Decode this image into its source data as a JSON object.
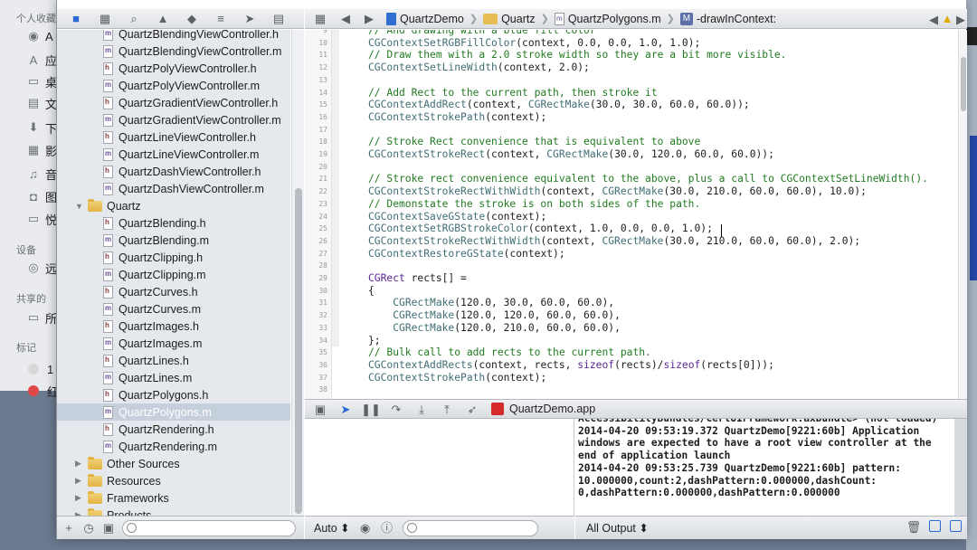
{
  "background_finder": {
    "sections": [
      "个人收藏",
      "设备",
      "共享的",
      "标记"
    ],
    "items": [
      {
        "icon": "airdrop-icon",
        "glyph": "◉",
        "label": "A"
      },
      {
        "icon": "applications-icon",
        "glyph": "A",
        "label": "应"
      },
      {
        "icon": "desktop-icon",
        "glyph": "▭",
        "label": "桌"
      },
      {
        "icon": "documents-icon",
        "glyph": "▤",
        "label": "文"
      },
      {
        "icon": "downloads-icon",
        "glyph": "⬇",
        "label": "下"
      },
      {
        "icon": "movies-icon",
        "glyph": "▦",
        "label": "影"
      },
      {
        "icon": "music-icon",
        "glyph": "♫",
        "label": "音"
      },
      {
        "icon": "pictures-icon",
        "glyph": "◘",
        "label": "图"
      },
      {
        "icon": "folder-icon",
        "glyph": "▭",
        "label": "悦"
      },
      {
        "icon": "disk-icon",
        "glyph": "◎",
        "label": "远"
      },
      {
        "icon": "network-icon",
        "glyph": "▭",
        "label": "所"
      }
    ],
    "tags": [
      {
        "label": "1",
        "color": "#d8d8d8"
      },
      {
        "label": "红",
        "color": "#e04848"
      }
    ]
  },
  "navigator": {
    "files": [
      {
        "type": "file",
        "ext": "m",
        "name": "QuartzBlendingViewController.h",
        "indent": 1
      },
      {
        "type": "file",
        "ext": "m",
        "name": "QuartzBlendingViewController.m",
        "indent": 1
      },
      {
        "type": "file",
        "ext": "h",
        "name": "QuartzPolyViewController.h",
        "indent": 1
      },
      {
        "type": "file",
        "ext": "m",
        "name": "QuartzPolyViewController.m",
        "indent": 1
      },
      {
        "type": "file",
        "ext": "h",
        "name": "QuartzGradientViewController.h",
        "indent": 1
      },
      {
        "type": "file",
        "ext": "m",
        "name": "QuartzGradientViewController.m",
        "indent": 1
      },
      {
        "type": "file",
        "ext": "h",
        "name": "QuartzLineViewController.h",
        "indent": 1
      },
      {
        "type": "file",
        "ext": "m",
        "name": "QuartzLineViewController.m",
        "indent": 1
      },
      {
        "type": "file",
        "ext": "h",
        "name": "QuartzDashViewController.h",
        "indent": 1
      },
      {
        "type": "file",
        "ext": "m",
        "name": "QuartzDashViewController.m",
        "indent": 1
      },
      {
        "type": "folder",
        "open": true,
        "name": "Quartz",
        "indent": 0
      },
      {
        "type": "file",
        "ext": "h",
        "name": "QuartzBlending.h",
        "indent": 1
      },
      {
        "type": "file",
        "ext": "m",
        "name": "QuartzBlending.m",
        "indent": 1
      },
      {
        "type": "file",
        "ext": "h",
        "name": "QuartzClipping.h",
        "indent": 1
      },
      {
        "type": "file",
        "ext": "m",
        "name": "QuartzClipping.m",
        "indent": 1
      },
      {
        "type": "file",
        "ext": "h",
        "name": "QuartzCurves.h",
        "indent": 1
      },
      {
        "type": "file",
        "ext": "m",
        "name": "QuartzCurves.m",
        "indent": 1
      },
      {
        "type": "file",
        "ext": "h",
        "name": "QuartzImages.h",
        "indent": 1
      },
      {
        "type": "file",
        "ext": "m",
        "name": "QuartzImages.m",
        "indent": 1
      },
      {
        "type": "file",
        "ext": "h",
        "name": "QuartzLines.h",
        "indent": 1
      },
      {
        "type": "file",
        "ext": "m",
        "name": "QuartzLines.m",
        "indent": 1
      },
      {
        "type": "file",
        "ext": "h",
        "name": "QuartzPolygons.h",
        "indent": 1
      },
      {
        "type": "file",
        "ext": "m",
        "name": "QuartzPolygons.m",
        "indent": 1,
        "selected": true
      },
      {
        "type": "file",
        "ext": "h",
        "name": "QuartzRendering.h",
        "indent": 1
      },
      {
        "type": "file",
        "ext": "m",
        "name": "QuartzRendering.m",
        "indent": 1
      },
      {
        "type": "folder",
        "open": false,
        "name": "Other Sources",
        "indent": 0
      },
      {
        "type": "folder",
        "open": false,
        "name": "Resources",
        "indent": 0
      },
      {
        "type": "folder",
        "open": false,
        "name": "Frameworks",
        "indent": 0
      },
      {
        "type": "folder",
        "open": false,
        "name": "Products",
        "indent": 0
      }
    ]
  },
  "jump_bar": {
    "project": "QuartzDemo",
    "group": "Quartz",
    "file": "QuartzPolygons.m",
    "method_badge": "M",
    "method": "-drawInContext:"
  },
  "editor": {
    "lines": [
      {
        "n": "9",
        "parts": [
          {
            "c": "c",
            "t": "// And drawing with a blue fill color"
          }
        ]
      },
      {
        "n": "10",
        "parts": [
          {
            "c": "f",
            "t": "CGContextSetRGBFillColor"
          },
          {
            "c": "",
            "t": "(context, 0.0, 0.0, 1.0, 1.0);"
          }
        ]
      },
      {
        "n": "11",
        "parts": [
          {
            "c": "c",
            "t": "// Draw them with a 2.0 stroke width so they are a bit more visible."
          }
        ]
      },
      {
        "n": "12",
        "parts": [
          {
            "c": "f",
            "t": "CGContextSetLineWidth"
          },
          {
            "c": "",
            "t": "(context, 2.0);"
          }
        ]
      },
      {
        "n": "13",
        "parts": []
      },
      {
        "n": "14",
        "parts": [
          {
            "c": "c",
            "t": "// Add Rect to the current path, then stroke it"
          }
        ]
      },
      {
        "n": "15",
        "parts": [
          {
            "c": "f",
            "t": "CGContextAddRect"
          },
          {
            "c": "",
            "t": "(context, "
          },
          {
            "c": "f",
            "t": "CGRectMake"
          },
          {
            "c": "",
            "t": "(30.0, 30.0, 60.0, 60.0));"
          }
        ]
      },
      {
        "n": "16",
        "parts": [
          {
            "c": "f",
            "t": "CGContextStrokePath"
          },
          {
            "c": "",
            "t": "(context);"
          }
        ]
      },
      {
        "n": "17",
        "parts": []
      },
      {
        "n": "18",
        "parts": [
          {
            "c": "c",
            "t": "// Stroke Rect convenience that is equivalent to above"
          }
        ]
      },
      {
        "n": "19",
        "parts": [
          {
            "c": "f",
            "t": "CGContextStrokeRect"
          },
          {
            "c": "",
            "t": "(context, "
          },
          {
            "c": "f",
            "t": "CGRectMake"
          },
          {
            "c": "",
            "t": "(30.0, 120.0, 60.0, 60.0));"
          }
        ]
      },
      {
        "n": "20",
        "parts": []
      },
      {
        "n": "21",
        "parts": [
          {
            "c": "c",
            "t": "// Stroke rect convenience equivalent to the above, plus a call to CGContextSetLineWidth()."
          }
        ]
      },
      {
        "n": "22",
        "parts": [
          {
            "c": "f",
            "t": "CGContextStrokeRectWithWidth"
          },
          {
            "c": "",
            "t": "(context, "
          },
          {
            "c": "f",
            "t": "CGRectMake"
          },
          {
            "c": "",
            "t": "(30.0, 210.0, 60.0, 60.0), 10.0);"
          }
        ]
      },
      {
        "n": "23",
        "parts": [
          {
            "c": "c",
            "t": "// Demonstate the stroke is on both sides of the path."
          }
        ]
      },
      {
        "n": "24",
        "parts": [
          {
            "c": "f",
            "t": "CGContextSaveGState"
          },
          {
            "c": "",
            "t": "(context);"
          }
        ]
      },
      {
        "n": "25",
        "parts": [
          {
            "c": "f",
            "t": "CGContextSetRGBStrokeColor"
          },
          {
            "c": "",
            "t": "(context, 1.0, 0.0, 0.0, 1.0);"
          }
        ]
      },
      {
        "n": "26",
        "parts": [
          {
            "c": "f",
            "t": "CGContextStrokeRectWithWidth"
          },
          {
            "c": "",
            "t": "(context, "
          },
          {
            "c": "f",
            "t": "CGRectMake"
          },
          {
            "c": "",
            "t": "(30.0, 210.0, 60.0, 60.0), 2.0);"
          }
        ]
      },
      {
        "n": "27",
        "parts": [
          {
            "c": "f",
            "t": "CGContextRestoreGState"
          },
          {
            "c": "",
            "t": "(context);"
          }
        ]
      },
      {
        "n": "28",
        "parts": []
      },
      {
        "n": "29",
        "parts": [
          {
            "c": "t",
            "t": "CGRect"
          },
          {
            "c": "",
            "t": " rects[] ="
          }
        ]
      },
      {
        "n": "30",
        "parts": [
          {
            "c": "",
            "t": "{"
          }
        ]
      },
      {
        "n": "31",
        "parts": [
          {
            "c": "",
            "t": "    "
          },
          {
            "c": "f",
            "t": "CGRectMake"
          },
          {
            "c": "",
            "t": "(120.0, 30.0, 60.0, 60.0),"
          }
        ]
      },
      {
        "n": "32",
        "parts": [
          {
            "c": "",
            "t": "    "
          },
          {
            "c": "f",
            "t": "CGRectMake"
          },
          {
            "c": "",
            "t": "(120.0, 120.0, 60.0, 60.0),"
          }
        ]
      },
      {
        "n": "33",
        "parts": [
          {
            "c": "",
            "t": "    "
          },
          {
            "c": "f",
            "t": "CGRectMake"
          },
          {
            "c": "",
            "t": "(120.0, 210.0, 60.0, 60.0),"
          }
        ]
      },
      {
        "n": "34",
        "parts": [
          {
            "c": "",
            "t": "};"
          }
        ]
      },
      {
        "n": "35",
        "parts": [
          {
            "c": "c",
            "t": "// Bulk call to add rects to the current path."
          }
        ]
      },
      {
        "n": "36",
        "parts": [
          {
            "c": "f",
            "t": "CGContextAddRects"
          },
          {
            "c": "",
            "t": "(context, rects, "
          },
          {
            "c": "t",
            "t": "sizeof"
          },
          {
            "c": "",
            "t": "(rects)/"
          },
          {
            "c": "t",
            "t": "sizeof"
          },
          {
            "c": "",
            "t": "(rects[0]));"
          }
        ]
      },
      {
        "n": "37",
        "parts": [
          {
            "c": "f",
            "t": "CGContextStrokePath"
          },
          {
            "c": "",
            "t": "(context);"
          }
        ]
      },
      {
        "n": "38",
        "parts": []
      }
    ]
  },
  "debug_bar": {
    "app_name": "QuartzDemo.app"
  },
  "console": {
    "text": "AccessibilityBundles/CertUIFramework.axbundle> (not loaded)\n2014-04-20 09:53:19.372 QuartzDemo[9221:60b] Application\nwindows are expected to have a root view controller at the\nend of application launch\n2014-04-20 09:53:25.739 QuartzDemo[9221:60b] pattern:\n10.000000,count:2,dashPattern:0.000000,dashCount:\n0,dashPattern:0.000000,dashPattern:0.000000"
  },
  "vars_bottom": {
    "scope_label": "Auto ⬍"
  },
  "console_bottom": {
    "output_label": "All Output ⬍"
  },
  "colors": {
    "accent": "#2a6ad2",
    "selected_row": "#c6cfdc",
    "comment": "#217a21",
    "function": "#3f6e74",
    "keyword": "#5c2699"
  }
}
